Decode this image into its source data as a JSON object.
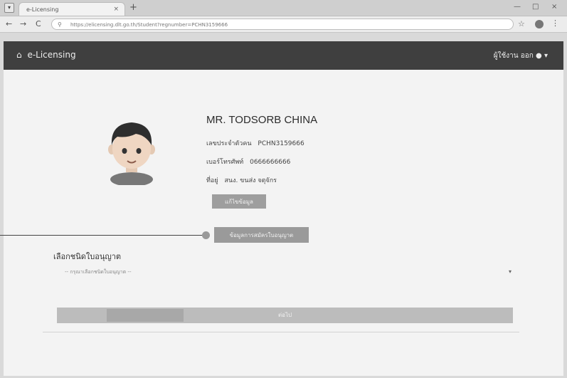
{
  "browser": {
    "tab_title": "e-Licensing",
    "tab_close": "×",
    "new_tab": "+",
    "url": "https://elicensing.dlt.go.th/Student?regnumber=PCHN3159666",
    "back": "←",
    "forward": "→",
    "reload": "C",
    "url_icon": "⚲",
    "star": "☆",
    "menu": "⋮",
    "minimize": "—",
    "restore": "□",
    "close": "×",
    "tab_menu": "▾"
  },
  "navbar": {
    "brand_icon": "home-icon",
    "brand": "e-Licensing",
    "user_menu": "ผู้ใช้งาน ออก"
  },
  "profile": {
    "name": "MR. TODSORB CHINA",
    "id_label": "เลขประจำตัวคน",
    "id_value": "PCHN3159666",
    "phone_label": "เบอร์โทรศัพท์",
    "phone_value": "0666666666",
    "address_label": "ที่อยู่",
    "address_value": "สนง. ขนส่ง จตุจักร",
    "edit_button": "แก้ไขข้อมูล",
    "license_button": "ข้อมูลการสมัครใบอนุญาต"
  },
  "license_section": {
    "title": "เลือกชนิดใบอนุญาต",
    "select_placeholder": "-- กรุณาเลือกชนิดใบอนุญาต --",
    "submit_button": "ต่อไป"
  },
  "colors": {
    "navbar": "#3f3f3f",
    "page_bg": "#f3f3f3",
    "button_gray": "#9e9e9e"
  }
}
